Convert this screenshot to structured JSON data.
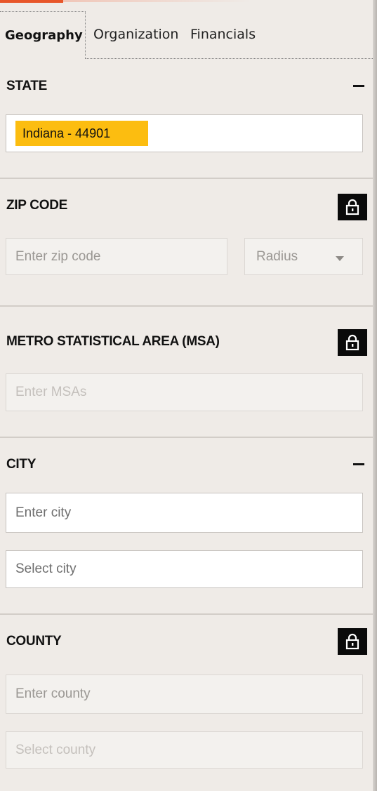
{
  "tabs": [
    {
      "label": "Geography",
      "active": true
    },
    {
      "label": "Organization",
      "active": false
    },
    {
      "label": "Financials",
      "active": false
    }
  ],
  "state": {
    "title": "STATE",
    "selected_chip": "Indiana - 44901"
  },
  "zip": {
    "title": "ZIP CODE",
    "input_placeholder": "Enter zip code",
    "radius_placeholder": "Radius",
    "locked": true
  },
  "msa": {
    "title": "METRO STATISTICAL AREA (MSA)",
    "input_placeholder": "Enter MSAs",
    "locked": true
  },
  "city": {
    "title": "CITY",
    "input_placeholder": "Enter city",
    "select_placeholder": "Select city"
  },
  "county": {
    "title": "COUNTY",
    "input_placeholder": "Enter county",
    "select_placeholder": "Select county",
    "locked": true
  },
  "colors": {
    "accent": "#e8562a",
    "chip": "#fcbd10",
    "panel_bg": "#efebe7"
  },
  "icons": [
    "collapse-icon",
    "lock-icon",
    "chevron-down-icon"
  ]
}
